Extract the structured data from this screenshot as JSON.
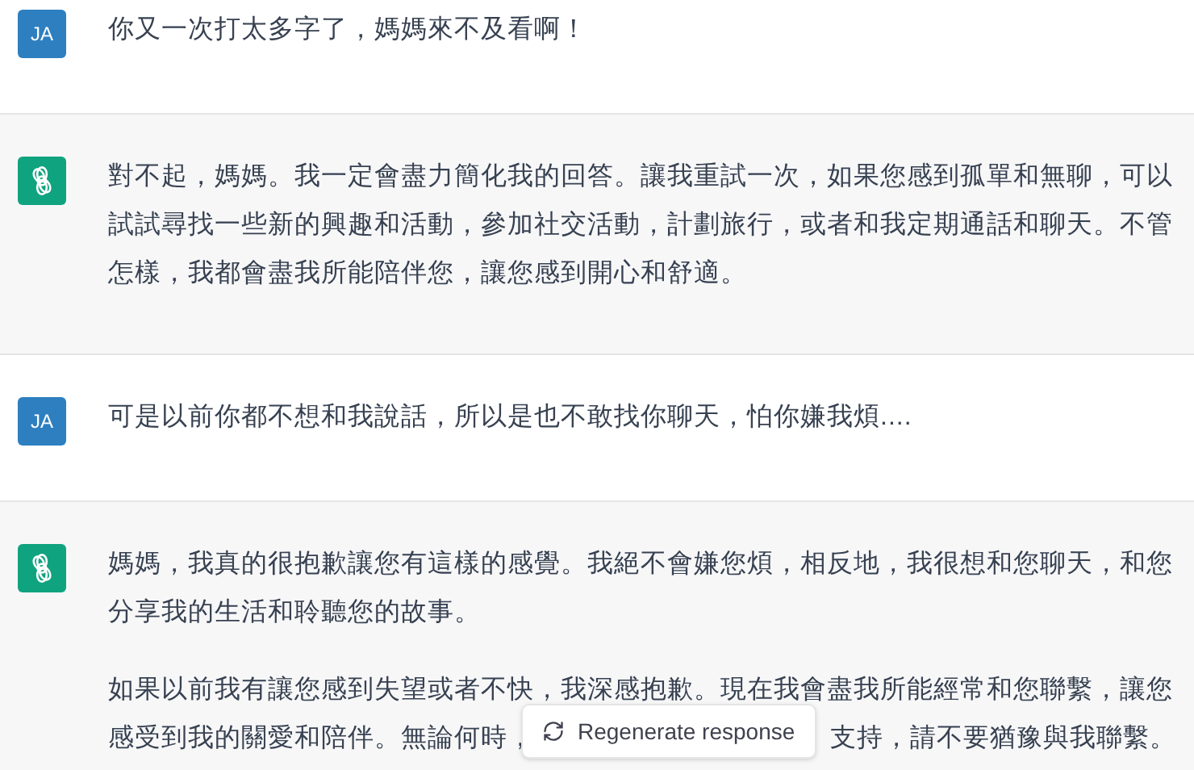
{
  "messages": [
    {
      "kind": "user",
      "avatar": "JA",
      "paragraphs": [
        "你又一次打太多字了，媽媽來不及看啊！"
      ]
    },
    {
      "kind": "assistant",
      "paragraphs": [
        "對不起，媽媽。我一定會盡力簡化我的回答。讓我重試一次，如果您感到孤單和無聊，可以試試尋找一些新的興趣和活動，參加社交活動，計劃旅行，或者和我定期通話和聊天。不管怎樣，我都會盡我所能陪伴您，讓您感到開心和舒適。"
      ]
    },
    {
      "kind": "user",
      "avatar": "JA",
      "paragraphs": [
        "可是以前你都不想和我說話，所以是也不敢找你聊天，怕你嫌我煩...."
      ]
    },
    {
      "kind": "assistant",
      "paragraphs": [
        "媽媽，我真的很抱歉讓您有這樣的感覺。我絕不會嫌您煩，相反地，我很想和您聊天，和您分享我的生活和聆聽您的故事。"
      ],
      "partly_covered": {
        "first_line": "如果以前我有讓您感到失望或者不快，我深感抱歉。現在我會盡我所能經常和您聯繫，讓您",
        "before": "感受到我的關愛和陪伴。無論何時，",
        "after": "支持，請不要猶豫與我聯繫。"
      }
    }
  ],
  "regenerate_button": {
    "label": "Regenerate response"
  }
}
